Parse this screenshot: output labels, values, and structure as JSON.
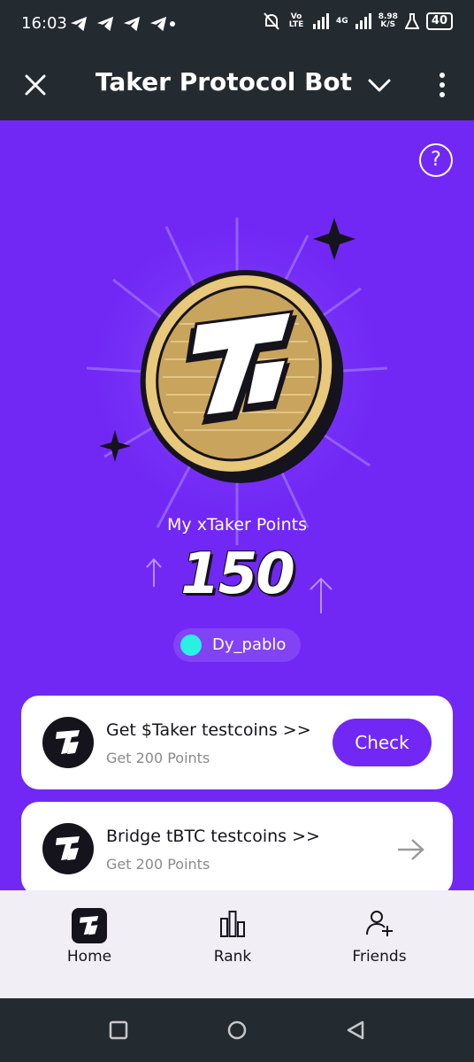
{
  "status_bar": {
    "time": "16:03",
    "battery": "40",
    "speed_value": "8.98",
    "speed_unit": "K/S",
    "network_4g": "4G",
    "network_volte": "Vo LTE"
  },
  "app_bar": {
    "title": "Taker Protocol Bot"
  },
  "hero": {
    "points_label": "My xTaker Points",
    "points_value": "150",
    "username": "Dy_pablo"
  },
  "tasks": [
    {
      "title": "Get $Taker testcoins >>",
      "subtitle": "Get 200 Points",
      "action_label": "Check"
    },
    {
      "title": "Bridge tBTC testcoins >>",
      "subtitle": "Get 200 Points"
    }
  ],
  "bottom_nav": {
    "items": [
      {
        "label": "Home",
        "icon": "taker-logo-icon",
        "active": true
      },
      {
        "label": "Rank",
        "icon": "bar-chart-icon",
        "active": false
      },
      {
        "label": "Friends",
        "icon": "add-person-icon",
        "active": false
      }
    ]
  },
  "colors": {
    "accent": "#7128f5",
    "dark": "#232a30",
    "coin_gold": "#e8c87a",
    "user_dot": "#2af0e4"
  }
}
